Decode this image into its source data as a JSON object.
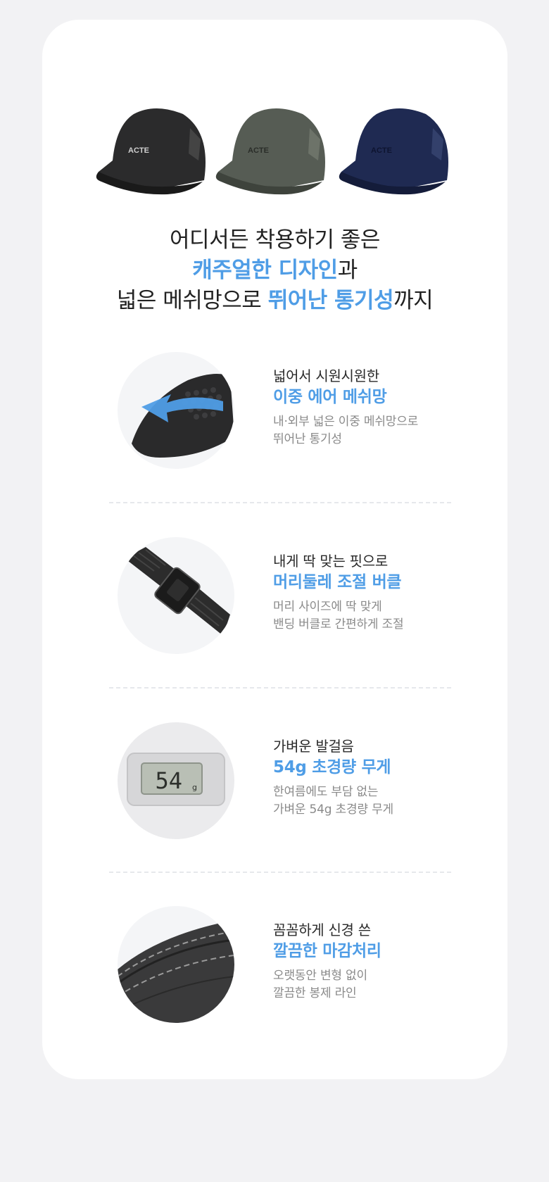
{
  "brand_logo": "ACTE",
  "headline": {
    "line1": "어디서든 착용하기 좋은",
    "line2_accent": "캐주얼한 디자인",
    "line2_suffix": "과",
    "line3_prefix": "넓은 메쉬망으로 ",
    "line3_accent": "뛰어난 통기성",
    "line3_suffix": "까지"
  },
  "colors": {
    "accent": "#4f9de6",
    "card": "#ffffff",
    "background": "#f2f2f4",
    "desc": "#8a8a8a"
  },
  "features": [
    {
      "icon": "mesh-icon",
      "subtitle": "넓어서 시원시원한",
      "title": "이중 에어 메쉬망",
      "desc_line1": "내·외부 넓은 이중 메쉬망으로",
      "desc_line2": "뛰어난 통기성"
    },
    {
      "icon": "buckle-icon",
      "subtitle": "내게 딱 맞는 핏으로",
      "title": "머리둘레 조절 버클",
      "desc_line1": "머리 사이즈에 딱 맞게",
      "desc_line2": "밴딩 버클로 간편하게 조절"
    },
    {
      "icon": "scale-icon",
      "scale_value": "54",
      "scale_unit": "g",
      "subtitle": "가벼운 발걸음",
      "title": "54g 초경량 무게",
      "desc_line1": "한여름에도 부담 없는",
      "desc_line2": "가벼운 54g 초경량 무게"
    },
    {
      "icon": "stitching-icon",
      "subtitle": "꼼꼼하게 신경 쓴",
      "title": "깔끔한 마감처리",
      "desc_line1": "오랫동안 변형 없이",
      "desc_line2": "깔끔한 봉제 라인"
    }
  ]
}
